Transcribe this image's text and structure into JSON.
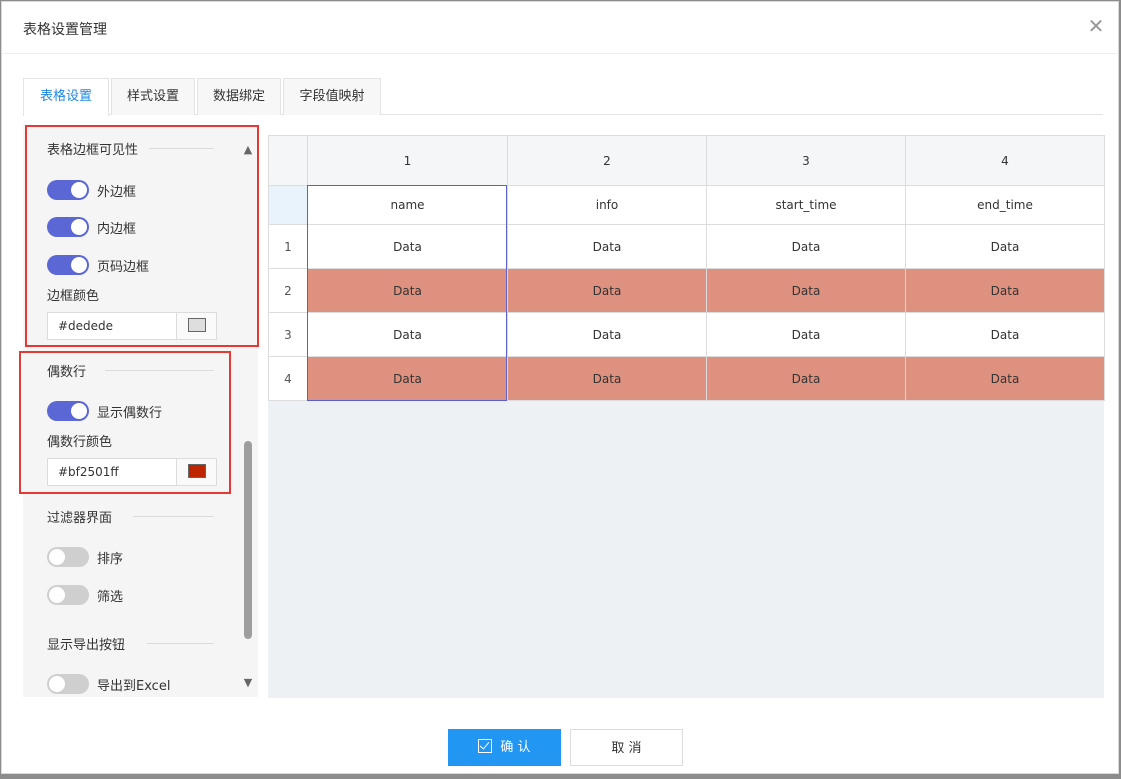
{
  "dialog": {
    "title": "表格设置管理",
    "close_glyph": "✕"
  },
  "tabs": [
    {
      "label": "表格设置",
      "active": true
    },
    {
      "label": "样式设置",
      "active": false
    },
    {
      "label": "数据绑定",
      "active": false
    },
    {
      "label": "字段值映射",
      "active": false
    }
  ],
  "panel": {
    "border_section": {
      "title": "表格边框可见性",
      "switches": [
        {
          "label": "外边框",
          "on": true
        },
        {
          "label": "内边框",
          "on": true
        },
        {
          "label": "页码边框",
          "on": true
        }
      ],
      "color_label": "边框颜色",
      "color_value": "#dedede",
      "swatch": "#dedede"
    },
    "even_section": {
      "title": "偶数行",
      "switch": {
        "label": "显示偶数行",
        "on": true
      },
      "color_label": "偶数行颜色",
      "color_value": "#bf2501ff",
      "swatch": "#bf2501"
    },
    "filter_section": {
      "title": "过滤器界面",
      "switches": [
        {
          "label": "排序",
          "on": false
        },
        {
          "label": "筛选",
          "on": false
        }
      ]
    },
    "export_section": {
      "title": "显示导出按钮",
      "switch": {
        "label": "导出到Excel",
        "on": false
      }
    },
    "scroll_up": "▲",
    "scroll_down": "▼"
  },
  "grid": {
    "column_numbers": [
      "1",
      "2",
      "3",
      "4"
    ],
    "fields": [
      "name",
      "info",
      "start_time",
      "end_time"
    ],
    "rows": [
      {
        "num": "1",
        "cells": [
          "Data",
          "Data",
          "Data",
          "Data"
        ]
      },
      {
        "num": "2",
        "cells": [
          "Data",
          "Data",
          "Data",
          "Data"
        ]
      },
      {
        "num": "3",
        "cells": [
          "Data",
          "Data",
          "Data",
          "Data"
        ]
      },
      {
        "num": "4",
        "cells": [
          "Data",
          "Data",
          "Data",
          "Data"
        ]
      }
    ],
    "even_row_color": "#df917f"
  },
  "footer": {
    "ok_label": "确 认",
    "cancel_label": "取 消"
  },
  "colors": {
    "accent": "#2196f3",
    "switch_on": "#5b67d4",
    "highlight": "#e53935"
  }
}
